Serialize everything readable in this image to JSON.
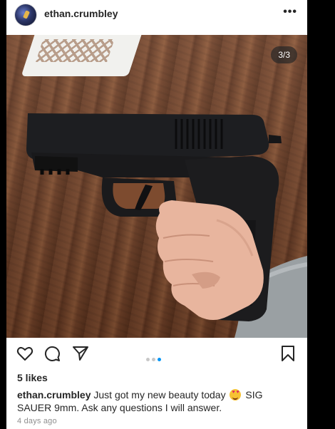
{
  "post": {
    "username": "ethan.crumbley",
    "more_icon": "more-horizontal-icon",
    "avatar_icon": "avatar",
    "image_counter": "3/3",
    "carousel": {
      "total": 3,
      "active_index": 2
    },
    "actions": {
      "like_icon": "heart-icon",
      "comment_icon": "comment-icon",
      "share_icon": "paper-plane-icon",
      "save_icon": "bookmark-icon"
    },
    "likes": "5 likes",
    "caption": {
      "username": "ethan.crumbley",
      "text_before_emoji": " Just got my new beauty today ",
      "emoji": "heart-eyes-emoji",
      "text_after_emoji": " SIG SAUER 9mm. Ask any questions I will answer."
    },
    "timestamp": "4 days ago"
  },
  "colors": {
    "accent_dot": "#0095f6",
    "text": "#262626",
    "secondary_text": "#8e8e8e",
    "background": "#000000"
  }
}
